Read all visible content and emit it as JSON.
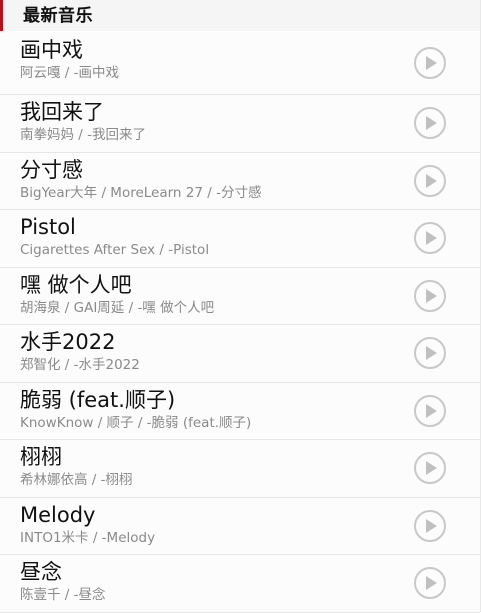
{
  "section": {
    "title": "最新音乐"
  },
  "songs": [
    {
      "title": "画中戏",
      "meta": "阿云嘎 / -画中戏"
    },
    {
      "title": "我回来了",
      "meta": "南拳妈妈 / -我回来了"
    },
    {
      "title": "分寸感",
      "meta": "BigYear大年 / MoreLearn 27 / -分寸感"
    },
    {
      "title": "Pistol",
      "meta": "Cigarettes After Sex / -Pistol"
    },
    {
      "title": "嘿 做个人吧",
      "meta": "胡海泉 / GAI周延 / -嘿 做个人吧"
    },
    {
      "title": "水手2022",
      "meta": "郑智化 / -水手2022"
    },
    {
      "title": "脆弱 (feat.顺子)",
      "meta": "KnowKnow / 顺子 / -脆弱 (feat.顺子)"
    },
    {
      "title": "栩栩",
      "meta": "希林娜依高 / -栩栩"
    },
    {
      "title": "Melody",
      "meta": "INTO1米卡 / -Melody"
    },
    {
      "title": "昼念",
      "meta": "陈壹千 / -昼念"
    }
  ],
  "icons": {
    "play": "play-icon"
  },
  "colors": {
    "accent": "#b3111c",
    "divider": "#e6e6e6",
    "meta_text": "#8a8a8a",
    "play_icon": "#c0c0c0"
  }
}
